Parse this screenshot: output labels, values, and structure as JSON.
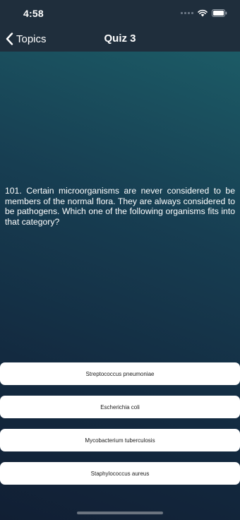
{
  "status_bar": {
    "time": "4:58",
    "icons": [
      "signal-dots-icon",
      "wifi-icon",
      "battery-icon"
    ]
  },
  "nav": {
    "back_label": "Topics",
    "title": "Quiz 3"
  },
  "question": {
    "text": "101. Certain microorganisms are never considered to be members of the normal flora. They are always considered to be pathogens. Which one of the following organisms fits into that category?"
  },
  "answers": [
    {
      "label": "Streptococcus pneumoniae"
    },
    {
      "label": "Escherichia coli"
    },
    {
      "label": "Mycobacterium tuberculosis"
    },
    {
      "label": "Staphylococcus aureus"
    }
  ],
  "colors": {
    "header": "#1f2e3c",
    "gradient_top": "#1c5b66",
    "gradient_bottom": "#111f34",
    "answer_bg": "#ffffff"
  }
}
